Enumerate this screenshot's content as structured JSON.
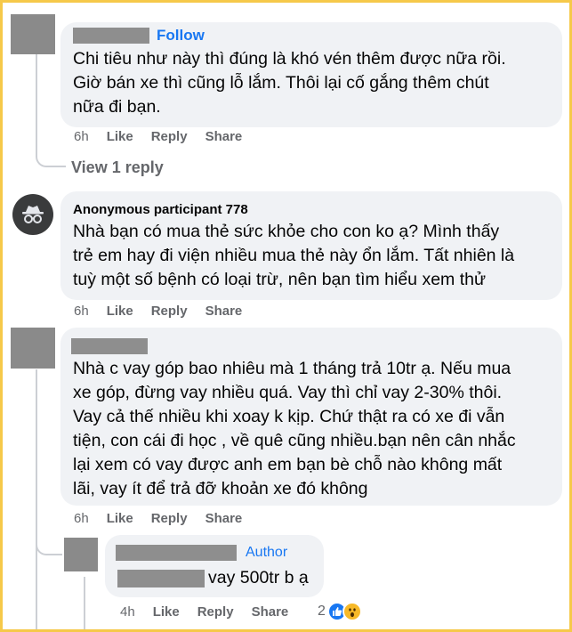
{
  "comments": [
    {
      "follow_label": "Follow",
      "lines": [
        "Chi tiêu như này thì đúng là khó vén thêm được nữa rồi.",
        "Giờ bán xe thì cũng lỗ lắm. Thôi lại cố gắng thêm chút",
        "nữa đi bạn."
      ],
      "time": "6h",
      "like": "Like",
      "reply": "Reply",
      "share": "Share"
    },
    {
      "view_replies": "View 1 reply"
    },
    {
      "author": "Anonymous participant 778",
      "lines": [
        "Nhà bạn có mua thẻ sức khỏe cho con ko ạ? Mình thấy",
        "trẻ em hay đi viện nhiều mua thẻ này ổn lắm. Tất nhiên là",
        "tuỳ một số bệnh có loại trừ, nên bạn tìm hiểu xem thử"
      ],
      "time": "6h",
      "like": "Like",
      "reply": "Reply",
      "share": "Share"
    },
    {
      "lines": [
        "Nhà c vay góp bao nhiêu mà 1 tháng trả 10tr ạ. Nếu mua",
        "xe góp, đừng vay nhiều quá. Vay thì chỉ vay 2-30% thôi.",
        "Vay cả thế nhiều khi xoay k kịp. Chứ thật ra có xe đi vẫn",
        "tiện, con cái đi học , về quê cũng nhiều.bạn nên cân nhắc",
        "lại xem có vay được anh em bạn bè chỗ nào không mất",
        "lãi, vay ít để trả đỡ khoản xe đó không"
      ],
      "time": "6h",
      "like": "Like",
      "reply": "Reply",
      "share": "Share"
    },
    {
      "author_badge": "Author",
      "text_suffix": "vay 500tr b ạ",
      "time": "4h",
      "like": "Like",
      "reply": "Reply",
      "share": "Share",
      "reaction_count": "2",
      "reactions": [
        "like-reaction-icon",
        "wow-reaction-icon"
      ]
    }
  ],
  "colors": {
    "accent": "#1877f2",
    "bubble": "#f0f2f5",
    "meta": "#65676b",
    "frame": "#f6c94a"
  }
}
